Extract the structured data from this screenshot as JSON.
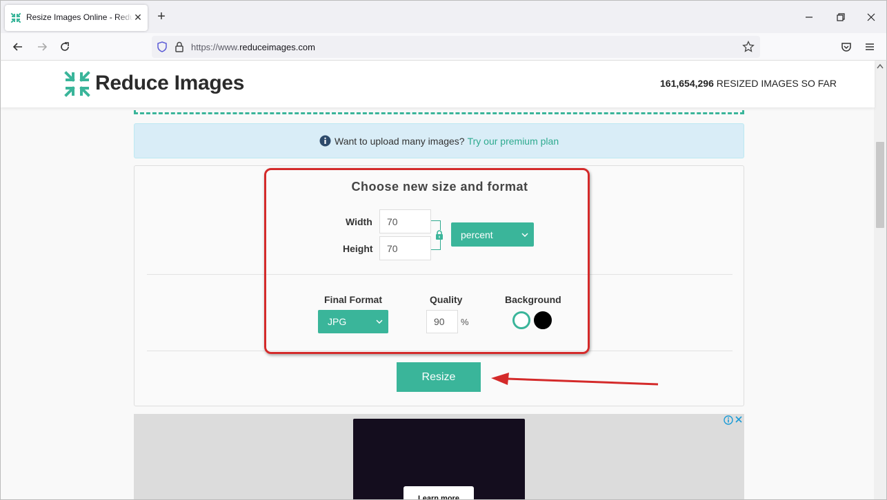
{
  "browser": {
    "tab_title": "Resize Images Online - Reduce Images",
    "url_prefix": "https://www.",
    "url_host": "reduceimages.com"
  },
  "site": {
    "logo_text": "Reduce Images",
    "counter_number": "161,654,296",
    "counter_label": "RESIZED IMAGES SO FAR"
  },
  "info_bar": {
    "text": "Want to upload many images?",
    "link_text": "Try our premium plan"
  },
  "resize_form": {
    "title": "Choose new size and format",
    "width_label": "Width",
    "width_value": "70",
    "height_label": "Height",
    "height_value": "70",
    "unit_selected": "percent",
    "final_format_label": "Final Format",
    "final_format_selected": "JPG",
    "quality_label": "Quality",
    "quality_value": "90",
    "quality_unit": "%",
    "background_label": "Background",
    "resize_button": "Resize"
  },
  "ad": {
    "learn_more": "Learn more"
  },
  "colors": {
    "accent": "#3ab59a",
    "annotation_red": "#d42a2a",
    "info_bg": "#d9edf7"
  }
}
